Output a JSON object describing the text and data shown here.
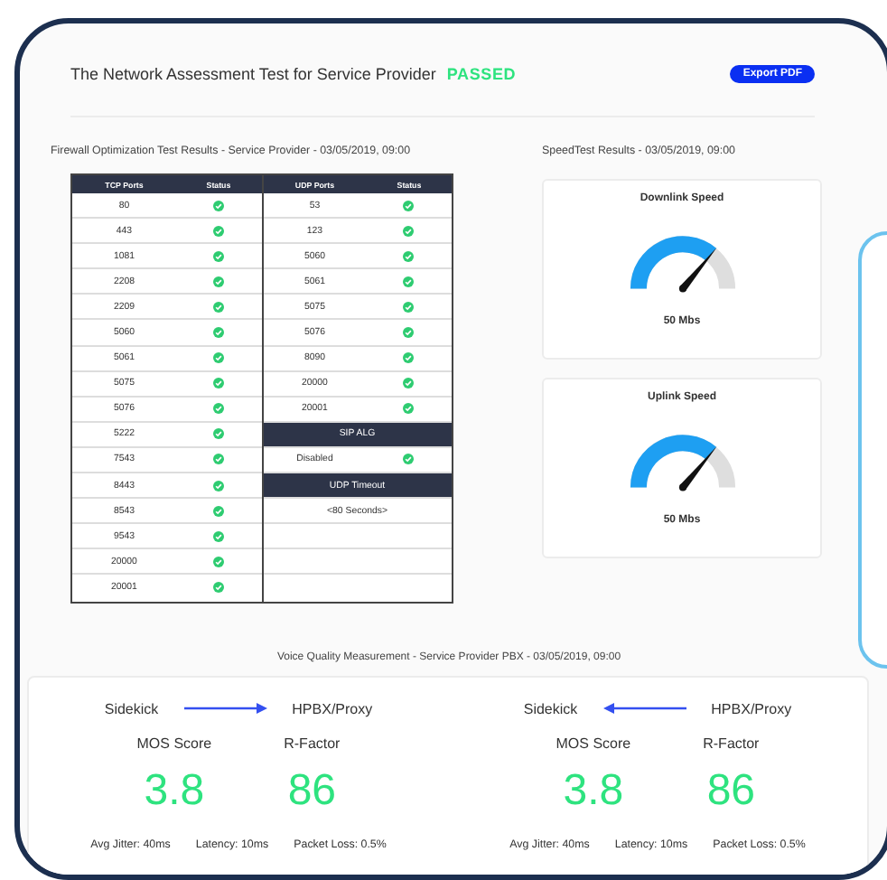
{
  "header": {
    "title": "The Network Assessment Test for Service Provider",
    "status": "PASSED",
    "export_button": "Export PDF"
  },
  "firewall": {
    "title": "Firewall Optimization Test Results -  Service Provider - 03/05/2019, 09:00",
    "columns": [
      "TCP Ports",
      "Status",
      "UDP Ports",
      "Status"
    ],
    "tcp": [
      {
        "port": "80",
        "passed": true
      },
      {
        "port": "443",
        "passed": true
      },
      {
        "port": "1081",
        "passed": true
      },
      {
        "port": "2208",
        "passed": true
      },
      {
        "port": "2209",
        "passed": true
      },
      {
        "port": "5060",
        "passed": true
      },
      {
        "port": "5061",
        "passed": true
      },
      {
        "port": "5075",
        "passed": true
      },
      {
        "port": "5076",
        "passed": true
      },
      {
        "port": "5222",
        "passed": true
      },
      {
        "port": "7543",
        "passed": true
      },
      {
        "port": "8443",
        "passed": true
      },
      {
        "port": "8543",
        "passed": true
      },
      {
        "port": "9543",
        "passed": true
      },
      {
        "port": "20000",
        "passed": true
      },
      {
        "port": "20001",
        "passed": true
      }
    ],
    "udp": [
      {
        "kind": "port",
        "text": "53",
        "passed": true
      },
      {
        "kind": "port",
        "text": "123",
        "passed": true
      },
      {
        "kind": "port",
        "text": "5060",
        "passed": true
      },
      {
        "kind": "port",
        "text": "5061",
        "passed": true
      },
      {
        "kind": "port",
        "text": "5075",
        "passed": true
      },
      {
        "kind": "port",
        "text": "5076",
        "passed": true
      },
      {
        "kind": "port",
        "text": "8090",
        "passed": true
      },
      {
        "kind": "port",
        "text": "20000",
        "passed": true
      },
      {
        "kind": "port",
        "text": "20001",
        "passed": true
      },
      {
        "kind": "header",
        "text": "SIP ALG"
      },
      {
        "kind": "port",
        "text": "Disabled",
        "passed": true
      },
      {
        "kind": "header",
        "text": "UDP Timeout"
      },
      {
        "kind": "value",
        "text": "<80 Seconds>"
      }
    ]
  },
  "speedtest": {
    "title": "SpeedTest Results - 03/05/2019, 09:00",
    "gauges": [
      {
        "label": "Downlink Speed",
        "reading": "50 Mbs"
      },
      {
        "label": "Uplink Speed",
        "reading": "50 Mbs"
      }
    ]
  },
  "voice": {
    "title": "Voice Quality Measurement - Service Provider PBX - 03/05/2019, 09:00",
    "directions": [
      {
        "from": "Sidekick",
        "to": "HPBX/Proxy",
        "kind": "outgoing",
        "mos_label": "MOS Score",
        "mos": "3.8",
        "rfactor_label": "R-Factor",
        "rfactor": "86",
        "stats": [
          "Avg Jitter: 40ms",
          "Latency: 10ms",
          "Packet Loss: 0.5%"
        ]
      },
      {
        "from": "Sidekick",
        "to": "HPBX/Proxy",
        "kind": "incoming",
        "mos_label": "MOS Score",
        "mos": "3.8",
        "rfactor_label": "R-Factor",
        "rfactor": "86",
        "stats": [
          "Avg Jitter: 40ms",
          "Latency: 10ms",
          "Packet Loss: 0.5%"
        ]
      }
    ]
  }
}
